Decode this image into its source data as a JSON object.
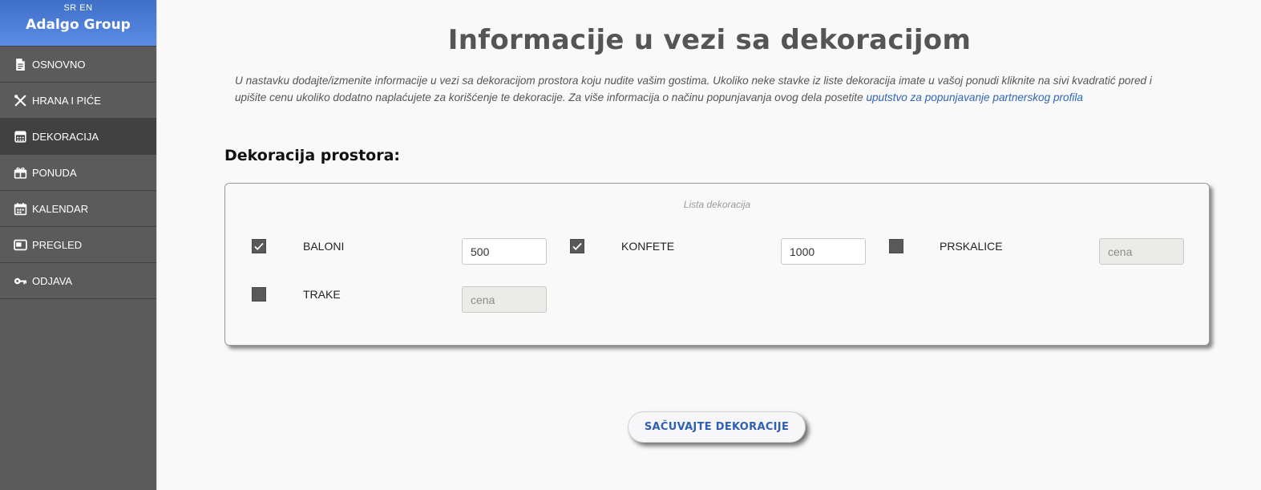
{
  "sidebar": {
    "lang_sr": "SR",
    "lang_en": "EN",
    "brand": "Adalgo Group",
    "items": [
      {
        "label": "OSNOVNO",
        "icon": "document-icon"
      },
      {
        "label": "HRANA I PIĆE",
        "icon": "utensils-icon"
      },
      {
        "label": "DEKORACIJA",
        "icon": "decoration-icon",
        "active": true
      },
      {
        "label": "PONUDA",
        "icon": "gift-box-icon"
      },
      {
        "label": "KALENDAR",
        "icon": "calendar-icon"
      },
      {
        "label": "PREGLED",
        "icon": "window-icon"
      },
      {
        "label": "ODJAVA",
        "icon": "key-icon"
      }
    ]
  },
  "main": {
    "title": "Informacije u vezi sa dekoracijom",
    "intro_text": "U nastavku dodajte/izmenite informacije u vezi sa dekoracijom prostora koju nudite vašim gostima. Ukoliko neke stavke iz liste dekoracija imate u vašoj ponudi kliknite na sivi kvadratić pored i upišite cenu ukoliko dodatno naplaćujete za korišćenje te dekoracije. Za više informacija o načinu popunjavanja ovog dela posetite",
    "intro_link": "uputstvo za popunjavanje partnerskog profila",
    "section_title": "Dekoracija prostora:",
    "list_caption": "Lista dekoracija",
    "price_placeholder": "cena",
    "decorations": [
      {
        "label": "BALONI",
        "checked": true,
        "price": "500"
      },
      {
        "label": "KONFETE",
        "checked": true,
        "price": "1000"
      },
      {
        "label": "PRSKALICE",
        "checked": false,
        "price": ""
      },
      {
        "label": "TRAKE",
        "checked": false,
        "price": ""
      }
    ],
    "save_label": "SAČUVAJTE DEKORACIJE"
  },
  "colors": {
    "sidebar_bg": "#5b5b5b",
    "sidebar_active": "#414141",
    "brand_gradient": [
      "#3f6fc7",
      "#5b8ce6"
    ],
    "link": "#2f66b5",
    "save_text": "#2f5fb0"
  }
}
